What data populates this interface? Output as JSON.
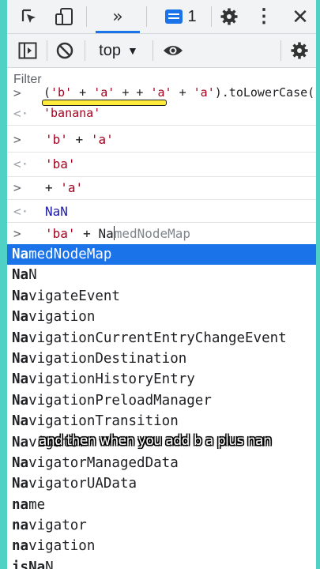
{
  "toolbar": {
    "issues_count": "1",
    "context": "top",
    "filter_placeholder": "Filter"
  },
  "console": {
    "entries": [
      {
        "input": [
          "'b'",
          " + ",
          "'a'",
          " + + ",
          "'a'",
          " + ",
          "'a'",
          ").toLowerCase()"
        ],
        "input_open": "(",
        "output": "'banana'"
      },
      {
        "input": [
          "'b'",
          " + ",
          "'a'"
        ],
        "output": "'ba'"
      },
      {
        "input": [
          "+ ",
          "'a'"
        ],
        "output": "NaN"
      }
    ],
    "current_input": {
      "prefix_str": "'ba'",
      "prefix_op": " + ",
      "typed": "Na",
      "ghost": "medNodeMap"
    }
  },
  "autocomplete": {
    "typed_prefix": "Na",
    "items": [
      {
        "prefix": "Na",
        "rest": "medNodeMap"
      },
      {
        "prefix": "Na",
        "rest": "N"
      },
      {
        "prefix": "Na",
        "rest": "vigateEvent"
      },
      {
        "prefix": "Na",
        "rest": "vigation"
      },
      {
        "prefix": "Na",
        "rest": "vigationCurrentEntryChangeEvent"
      },
      {
        "prefix": "Na",
        "rest": "vigationDestination"
      },
      {
        "prefix": "Na",
        "rest": "vigationHistoryEntry"
      },
      {
        "prefix": "Na",
        "rest": "vigationPreloadManager"
      },
      {
        "prefix": "Na",
        "rest": "vigationTransition"
      },
      {
        "prefix": "Na",
        "rest": "vigator"
      },
      {
        "prefix": "Na",
        "rest": "vigatorManagedData"
      },
      {
        "prefix": "Na",
        "rest": "vigatorUAData"
      },
      {
        "prefix": "na",
        "rest": "me"
      },
      {
        "prefix": "na",
        "rest": "vigator"
      },
      {
        "prefix": "na",
        "rest": "vigation"
      },
      {
        "prefix": "isNa",
        "rest": "N"
      }
    ]
  },
  "caption": "and then when you add b a plus nan",
  "colors": {
    "accent": "#1a73e8",
    "string": "#a3021f",
    "highlight": "#ffeb3b",
    "border": "#4fd1c5"
  }
}
